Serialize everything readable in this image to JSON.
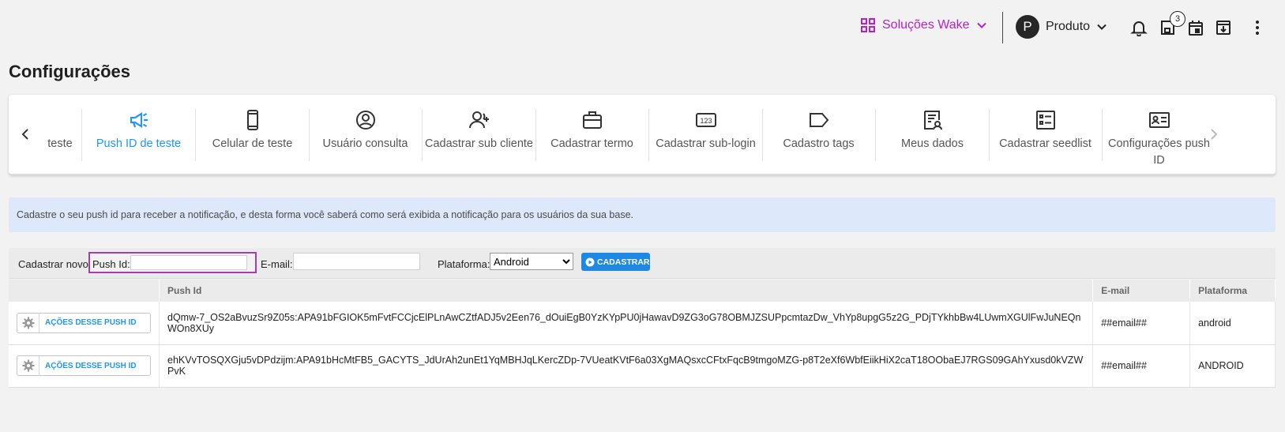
{
  "header": {
    "brand_label": "Soluções Wake",
    "avatar_letter": "P",
    "user_label": "Produto",
    "badge_count": "3"
  },
  "page": {
    "title": "Configurações"
  },
  "tabs": [
    {
      "label": "teste",
      "icon": "partial-icon"
    },
    {
      "label": "Push ID de teste",
      "icon": "megaphone-icon",
      "active": true
    },
    {
      "label": "Celular de teste",
      "icon": "smartphone-icon"
    },
    {
      "label": "Usuário consulta",
      "icon": "user-circle-icon"
    },
    {
      "label": "Cadastrar sub cliente",
      "icon": "user-add-icon"
    },
    {
      "label": "Cadastrar termo",
      "icon": "briefcase-icon"
    },
    {
      "label": "Cadastrar sub-login",
      "icon": "number-box-icon"
    },
    {
      "label": "Cadastro tags",
      "icon": "tag-icon"
    },
    {
      "label": "Meus dados",
      "icon": "user-document-icon"
    },
    {
      "label": "Cadastrar seedlist",
      "icon": "checklist-icon"
    },
    {
      "label": "Configurações push ID",
      "icon": "id-card-icon"
    }
  ],
  "tab_number_icon_text": "123",
  "info": {
    "text": "Cadastre o seu push id para receber a notificação, e desta forma você saberá como será exibida a notificação para os usuários da sua base."
  },
  "form": {
    "new_label": "Cadastrar novo:",
    "push_id_label": "Push Id:",
    "push_id_value": "",
    "email_label": "E-mail:",
    "email_value": "",
    "platform_label": "Plataforma:",
    "platform_selected": "Android",
    "submit_label": "CADASTRAR"
  },
  "table": {
    "columns": [
      "",
      "Push Id",
      "E-mail",
      "Plataforma"
    ],
    "rows": [
      {
        "action_label": "AÇÕES DESSE PUSH ID",
        "push_id": "dQmw-7_OS2aBvuzSr9Z05s:APA91bFGIOK5mFvtFCCjcElPLnAwCZtfADJ5v2Een76_dOuiEgB0YzKYpPU0jHawavD9ZG3oG78OBMJZSUPpcmtazDw_VhYp8upgG5z2G_PDjTYkhbBw4LUwmXGUlFwJuNEQnWOn8XUy",
        "email": "##email##",
        "platform": "android"
      },
      {
        "action_label": "AÇÕES DESSE PUSH ID",
        "push_id": "ehKVvTOSQXGju5vDPdzijm:APA91bHcMtFB5_GACYTS_JdUrAh2unEt1YqMBHJqLKercZDp-7VUeatKVtF6a03XgMAQsxcCFtxFqcB9tmgoMZG-p8T2eXf6WbfEiikHiX2caT18OObaEJ7RGS09GAhYxusd0kVZWPvK",
        "email": "##email##",
        "platform": "ANDROID"
      }
    ]
  },
  "colors": {
    "brand": "#b423c7",
    "accent": "#2196f3",
    "info_bg": "#dde9fb",
    "highlight_border": "#a43ea8"
  }
}
